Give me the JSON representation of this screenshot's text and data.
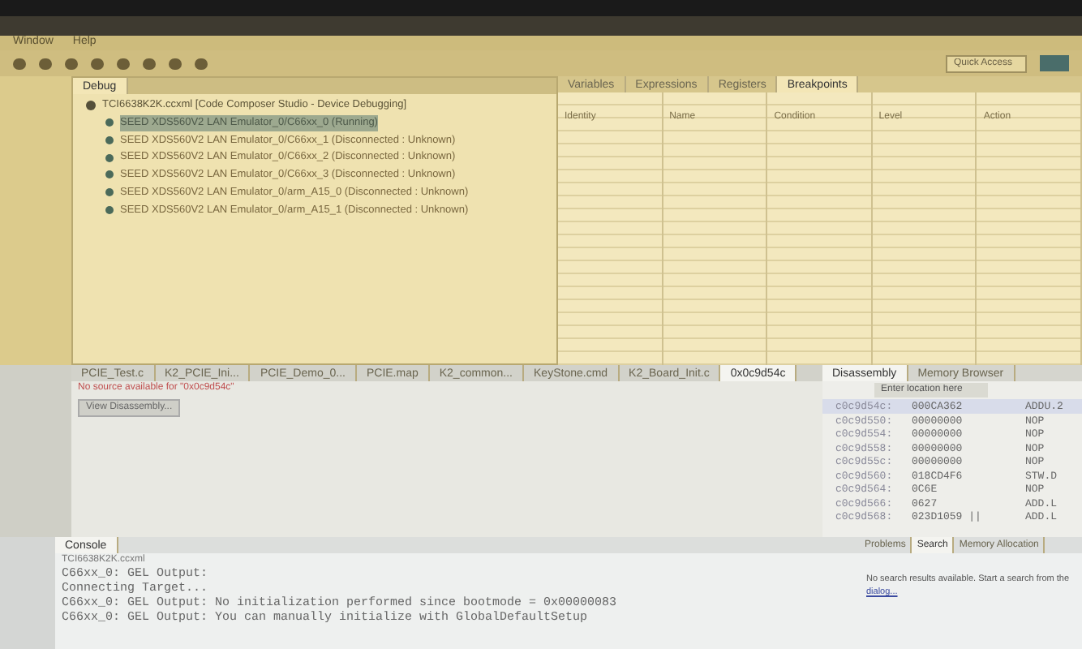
{
  "menu": [
    "Window",
    "Help"
  ],
  "quick_access": {
    "placeholder": "Quick Access"
  },
  "debug": {
    "tab": "Debug",
    "root": "TCI6638K2K.ccxml [Code Composer Studio - Device Debugging]",
    "children": [
      {
        "label": "SEED XDS560V2 LAN Emulator_0/C66xx_0 (Running)",
        "selected": true
      },
      {
        "label": "SEED XDS560V2 LAN Emulator_0/C66xx_1 (Disconnected : Unknown)",
        "selected": false
      },
      {
        "label": "SEED XDS560V2 LAN Emulator_0/C66xx_2 (Disconnected : Unknown)",
        "selected": false
      },
      {
        "label": "SEED XDS560V2 LAN Emulator_0/C66xx_3 (Disconnected : Unknown)",
        "selected": false
      },
      {
        "label": "SEED XDS560V2 LAN Emulator_0/arm_A15_0 (Disconnected : Unknown)",
        "selected": false
      },
      {
        "label": "SEED XDS560V2 LAN Emulator_0/arm_A15_1 (Disconnected : Unknown)",
        "selected": false
      }
    ]
  },
  "breakpoints": {
    "tabs": [
      {
        "label": "Variables",
        "selected": false
      },
      {
        "label": "Expressions",
        "selected": false
      },
      {
        "label": "Registers",
        "selected": false
      },
      {
        "label": "Breakpoints",
        "selected": true
      }
    ],
    "columns": [
      "Identity",
      "Name",
      "Condition",
      "Level",
      "Action"
    ]
  },
  "editor": {
    "tabs": [
      {
        "label": "PCIE_Test.c",
        "selected": false
      },
      {
        "label": "K2_PCIE_Ini...",
        "selected": false
      },
      {
        "label": "PCIE_Demo_0...",
        "selected": false
      },
      {
        "label": "PCIE.map",
        "selected": false
      },
      {
        "label": "K2_common...",
        "selected": false
      },
      {
        "label": "KeyStone.cmd",
        "selected": false
      },
      {
        "label": "K2_Board_Init.c",
        "selected": false
      },
      {
        "label": "0x0c9d54c",
        "selected": true
      }
    ],
    "message": "No source available for \"0x0c9d54c\"",
    "button": "View Disassembly..."
  },
  "disassembly": {
    "tabs": [
      {
        "label": "Disassembly",
        "selected": true
      },
      {
        "label": "Memory Browser",
        "selected": false
      }
    ],
    "location": {
      "placeholder": "Enter location here"
    },
    "rows": [
      {
        "address": "c0c9d54c:",
        "code": "000CA362",
        "instruction": "ADDU.2",
        "selected": true
      },
      {
        "address": "c0c9d550:",
        "code": "00000000",
        "instruction": "NOP",
        "selected": false
      },
      {
        "address": "c0c9d554:",
        "code": "00000000",
        "instruction": "NOP",
        "selected": false
      },
      {
        "address": "c0c9d558:",
        "code": "00000000",
        "instruction": "NOP",
        "selected": false
      },
      {
        "address": "c0c9d55c:",
        "code": "00000000",
        "instruction": "NOP",
        "selected": false
      },
      {
        "address": "c0c9d560:",
        "code": "018CD4F6",
        "instruction": "STW.D",
        "selected": false
      },
      {
        "address": "c0c9d564:",
        "code": "0C6E",
        "instruction": "NOP",
        "selected": false
      },
      {
        "address": "c0c9d566:",
        "code": "0627",
        "instruction": "ADD.L",
        "selected": false
      },
      {
        "address": "c0c9d568:",
        "code": "023D1059 ||",
        "instruction": "ADD.L",
        "selected": false
      }
    ]
  },
  "console": {
    "tab": "Console",
    "subtitle": "TCI6638K2K.ccxml",
    "lines": [
      "C66xx_0: GEL Output:",
      "Connecting Target...",
      "C66xx_0: GEL Output: No initialization performed since bootmode = 0x00000083",
      "C66xx_0: GEL Output: You can manually initialize with GlobalDefaultSetup"
    ]
  },
  "search": {
    "tabs": [
      {
        "label": "Problems",
        "selected": false
      },
      {
        "label": "Search",
        "selected": true
      },
      {
        "label": "Memory Allocation",
        "selected": false
      }
    ],
    "message": "No search results available. Start a search from the",
    "link": "dialog..."
  }
}
